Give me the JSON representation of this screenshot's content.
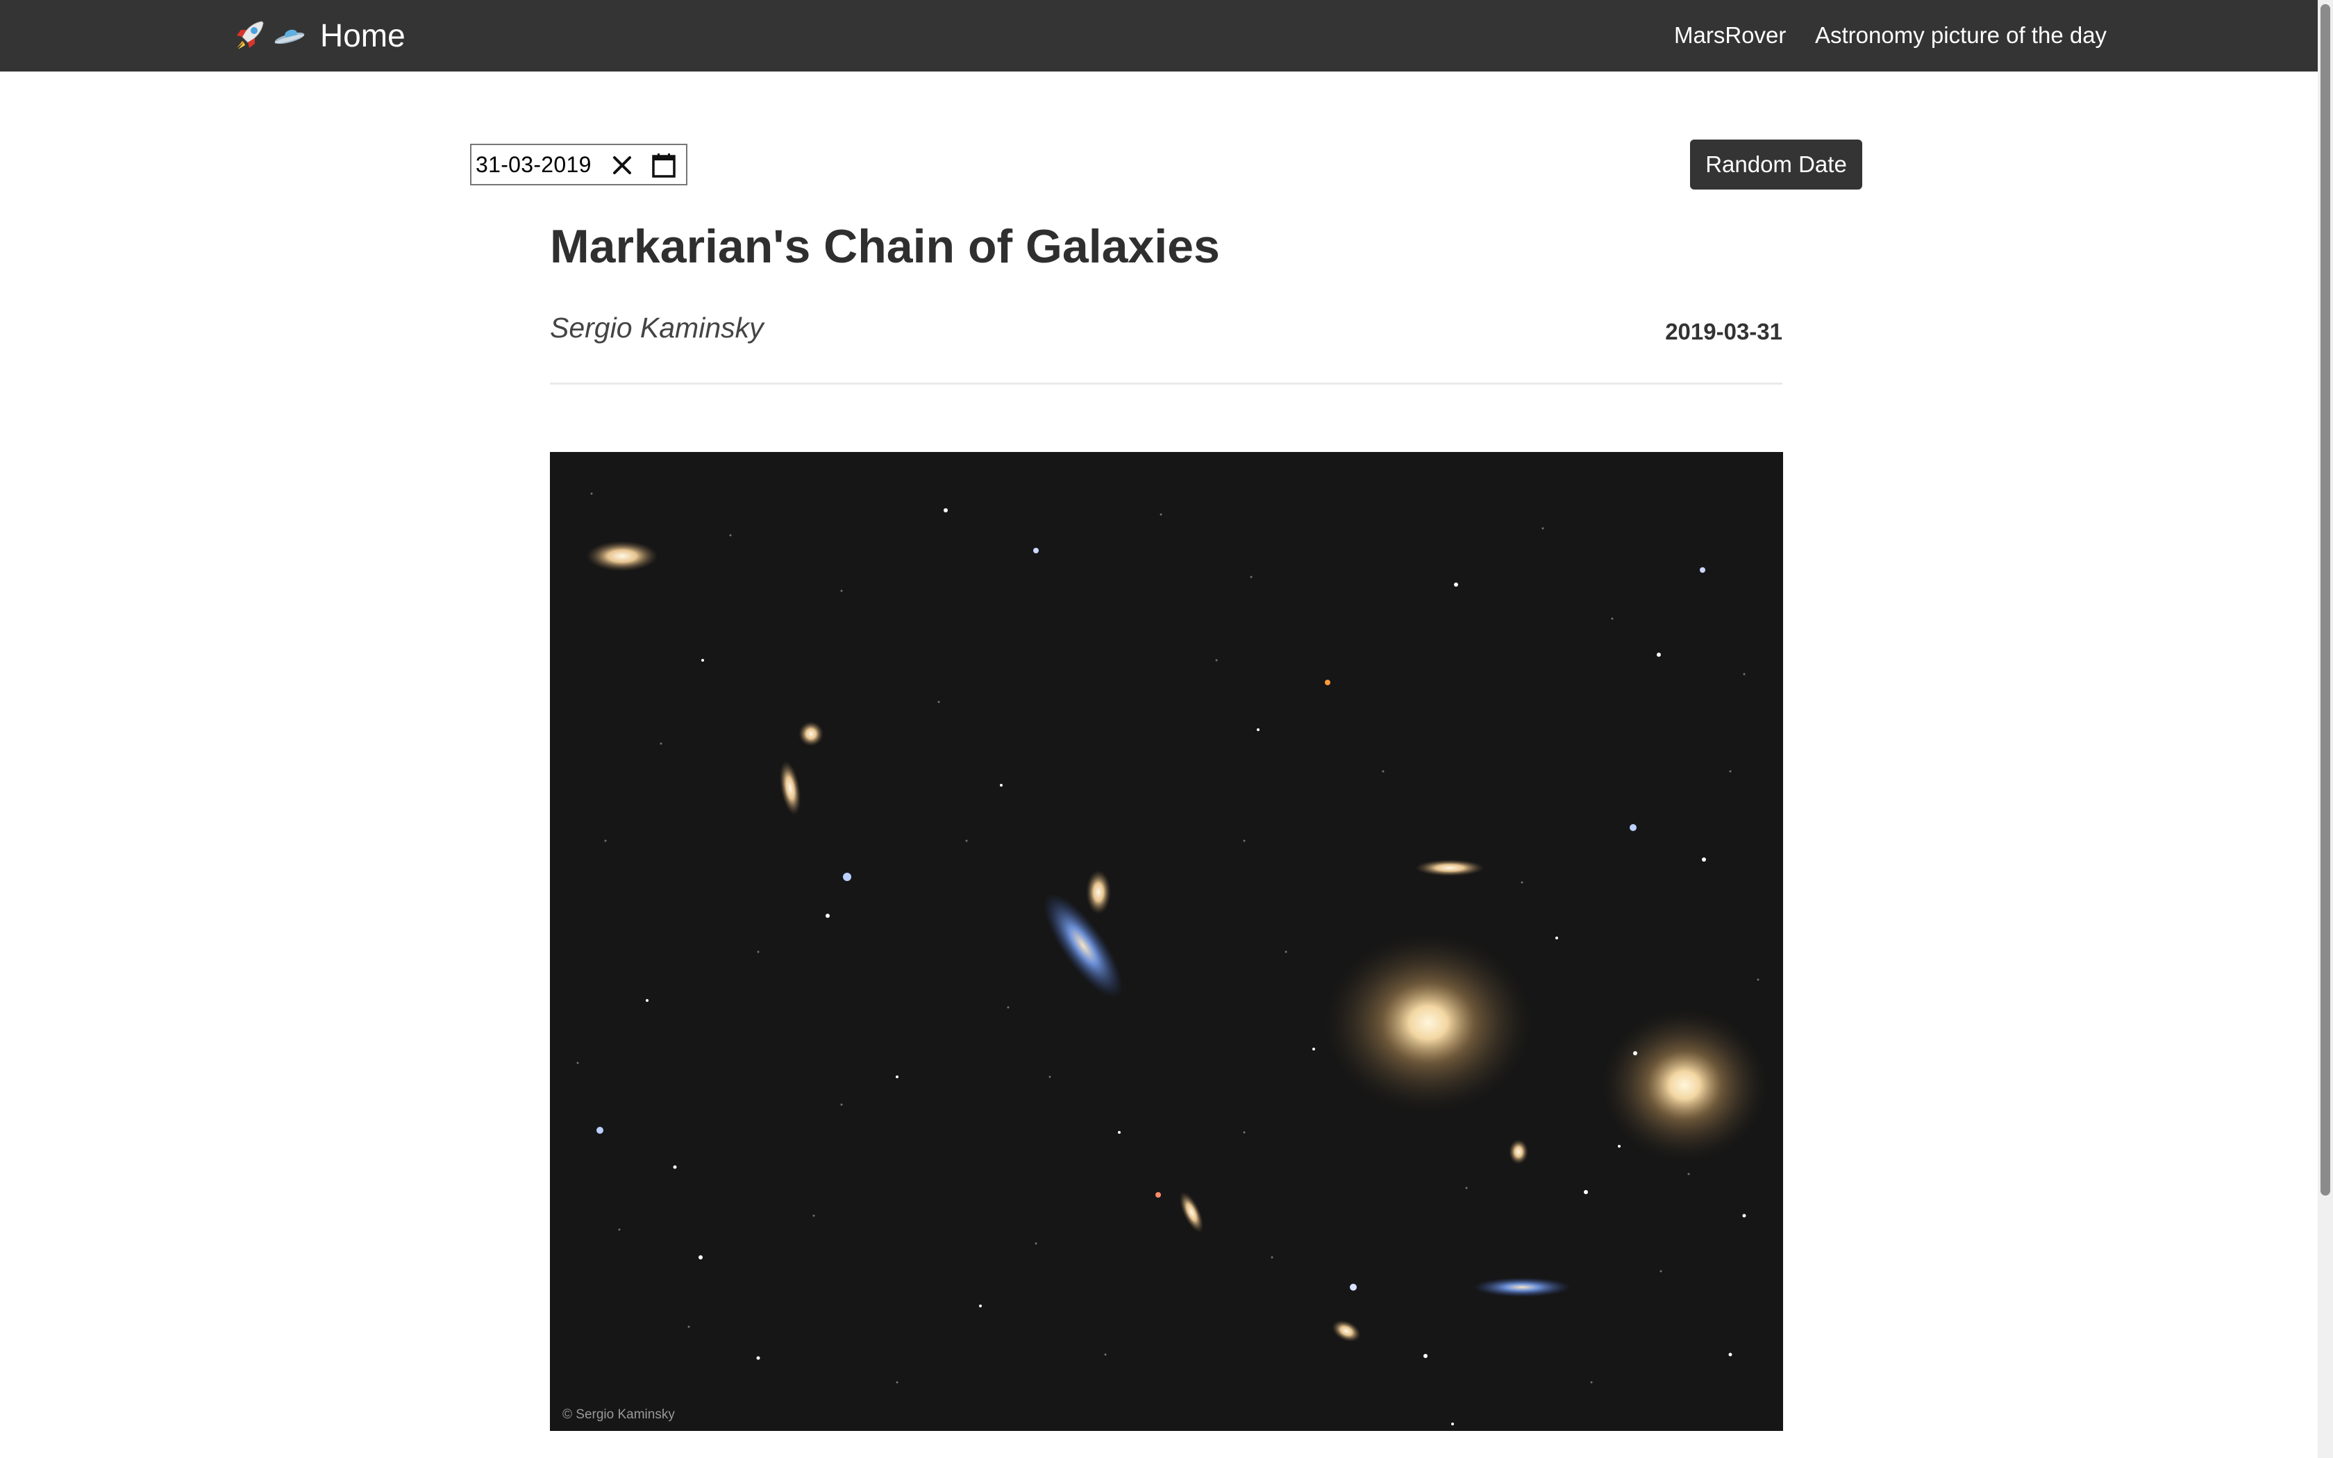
{
  "navbar": {
    "brand_label": "Home",
    "brand_icons": [
      "rocket-icon",
      "flying-saucer-icon"
    ],
    "links": [
      "MarsRover",
      "Astronomy picture of the day"
    ],
    "background": "#343434"
  },
  "date_picker": {
    "value": "31-03-2019"
  },
  "random_button": {
    "label": "Random Date"
  },
  "article": {
    "title": "Markarian's Chain of Galaxies",
    "author": "Sergio Kaminsky",
    "date": "2019-03-31",
    "image_credit": "© Sergio Kaminsky"
  }
}
